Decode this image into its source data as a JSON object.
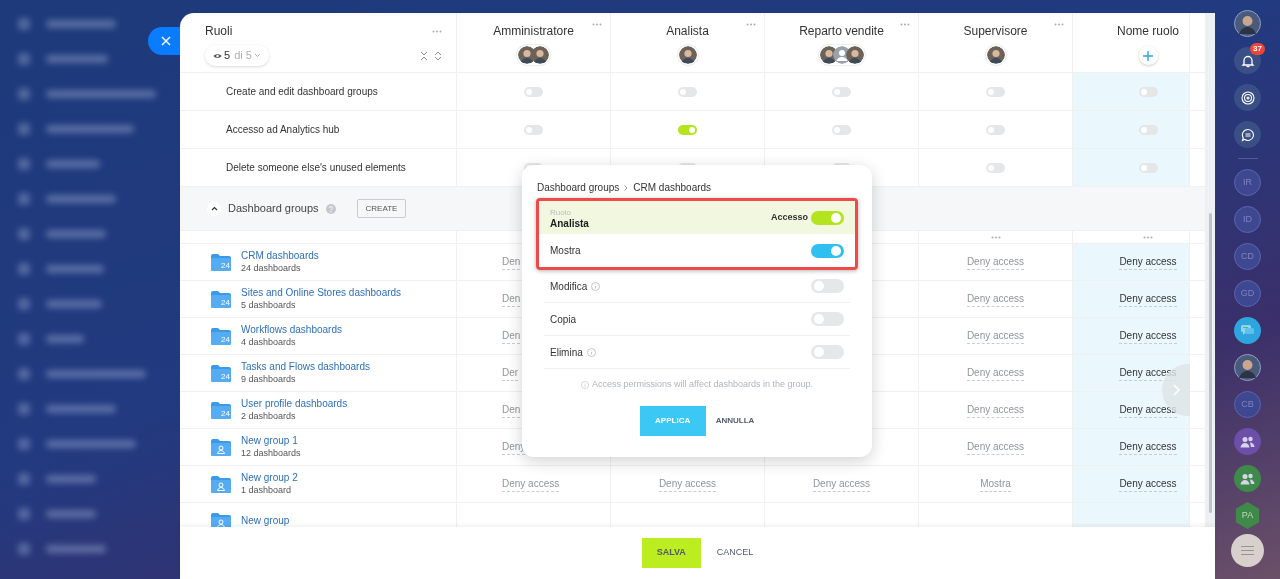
{
  "header": {
    "title": "Ruoli",
    "filter": {
      "count": "5",
      "total": "di 5"
    }
  },
  "roles": [
    {
      "name": "Amministratore",
      "kind": "role",
      "avatars": [
        {
          "kind": "photo"
        },
        {
          "kind": "photo"
        }
      ]
    },
    {
      "name": "Analista",
      "kind": "role",
      "avatars": [
        {
          "kind": "photo"
        }
      ]
    },
    {
      "name": "Reparto vendite",
      "kind": "role",
      "avatars": [
        {
          "kind": "photo"
        },
        {
          "kind": "placeholder"
        },
        {
          "kind": "photo"
        }
      ]
    },
    {
      "name": "Supervisore",
      "kind": "role",
      "avatars": [
        {
          "kind": "photo"
        }
      ]
    },
    {
      "name": "Nome ruolo",
      "kind": "new"
    }
  ],
  "permissions": [
    {
      "label": "Create and edit dashboard groups",
      "values": [
        false,
        false,
        false,
        false,
        false
      ]
    },
    {
      "label": "Accesso ad Analytics hub",
      "values": [
        false,
        true,
        false,
        false,
        false
      ]
    },
    {
      "label": "Delete someone else's unused elements",
      "values": [
        false,
        false,
        false,
        false,
        false
      ]
    }
  ],
  "section": {
    "title": "Dashboard groups",
    "expanded": true,
    "button": "CREATE"
  },
  "groups": [
    {
      "name": "CRM dashboards",
      "count": "24 dashboards",
      "kind": "app",
      "icon_text": "24",
      "cells": [
        "Den",
        null,
        null,
        "Deny access",
        "Deny access"
      ]
    },
    {
      "name": "Sites and Online Stores dashboards",
      "count": "5 dashboards",
      "kind": "app",
      "icon_text": "24",
      "cells": [
        "Den",
        null,
        null,
        "Deny access",
        "Deny access"
      ]
    },
    {
      "name": "Workflows dashboards",
      "count": "4 dashboards",
      "kind": "app",
      "icon_text": "24",
      "cells": [
        "Den",
        null,
        null,
        "Deny access",
        "Deny access"
      ]
    },
    {
      "name": "Tasks and Flows dashboards",
      "count": "9 dashboards",
      "kind": "app",
      "icon_text": "24",
      "cells": [
        "Der",
        null,
        null,
        "Deny access",
        "Deny access"
      ]
    },
    {
      "name": "User profile dashboards",
      "count": "2 dashboards",
      "kind": "app",
      "icon_text": "24",
      "cells": [
        "Den",
        null,
        null,
        "Deny access",
        "Deny access"
      ]
    },
    {
      "name": "New group 1",
      "count": "12 dashboards",
      "kind": "user",
      "cells": [
        "Deny",
        null,
        null,
        "Deny access",
        "Deny access"
      ]
    },
    {
      "name": "New group 2",
      "count": "1 dashboard",
      "kind": "user",
      "cells": [
        "Deny access",
        "Deny access",
        "Deny access",
        "Mostra",
        "Deny access"
      ]
    },
    {
      "name": "New group",
      "kind": "user"
    }
  ],
  "popover": {
    "breadcrumb": [
      "Dashboard groups",
      "CRM dashboards"
    ],
    "role_label": "Ruolo",
    "role_name": "Analista",
    "access_label": "Accesso",
    "access_on": true,
    "rows": [
      {
        "label": "Mostra",
        "on": true,
        "info": false
      },
      {
        "label": "Modifica",
        "on": false,
        "info": true
      },
      {
        "label": "Copia",
        "on": false,
        "info": false
      },
      {
        "label": "Elimina",
        "on": false,
        "info": true
      }
    ],
    "note": "Access permissions will affect dashboards in the group.",
    "apply": "APPLICA",
    "cancel": "ANNULLA"
  },
  "footer": {
    "save": "SALVA",
    "cancel": "CANCEL"
  },
  "right_bar": [
    {
      "kind": "avatar"
    },
    {
      "kind": "bell",
      "badge": "37"
    },
    {
      "kind": "radar"
    },
    {
      "kind": "chat"
    },
    {
      "kind": "divider"
    },
    {
      "kind": "initials",
      "text": "IR"
    },
    {
      "kind": "initials",
      "text": "ID"
    },
    {
      "kind": "initials",
      "text": "CD"
    },
    {
      "kind": "initials",
      "text": "GD"
    },
    {
      "kind": "messages"
    },
    {
      "kind": "avatar"
    },
    {
      "kind": "initials",
      "text": "CB"
    },
    {
      "kind": "group",
      "color": "#6b4fa8"
    },
    {
      "kind": "group",
      "color": "#3f8a4a"
    },
    {
      "kind": "hex",
      "text": "PA"
    }
  ]
}
